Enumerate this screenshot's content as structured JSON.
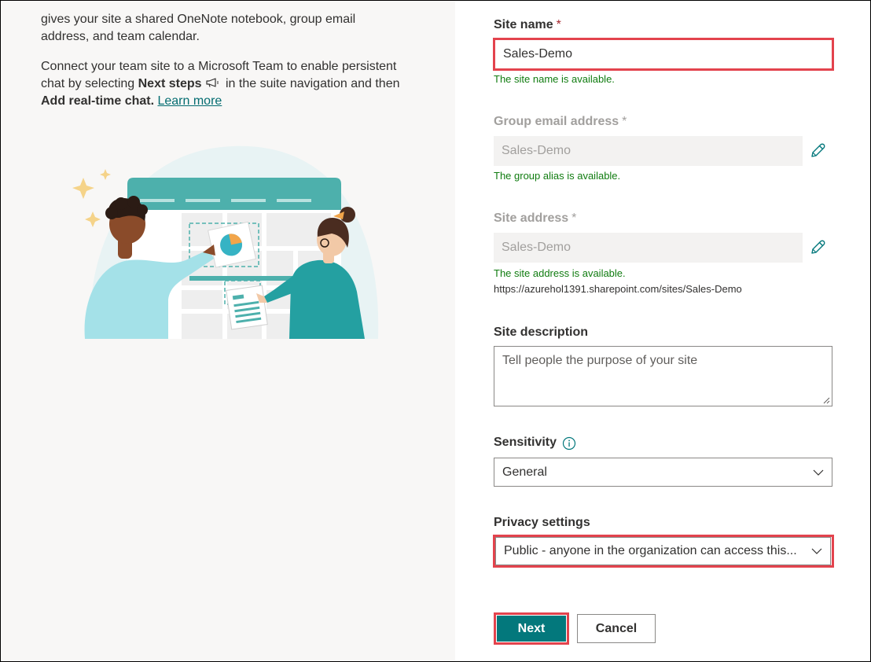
{
  "left": {
    "intro_line1": "gives your site a shared OneNote notebook, group email",
    "intro_line2": "address, and team calendar.",
    "connect_line1": "Connect your team site to a Microsoft Team to enable persistent",
    "connect_prefix": "chat by selecting ",
    "next_steps": "Next steps",
    "connect_suffix": " in the suite navigation and then",
    "add_chat": "Add real-time chat.",
    "learn_more": "Learn more"
  },
  "form": {
    "site_name": {
      "label": "Site name",
      "required": "*",
      "value": "Sales-Demo",
      "status": "The site name is available."
    },
    "group_email": {
      "label": "Group email address",
      "required": "*",
      "value": "Sales-Demo",
      "status": "The group alias is available."
    },
    "site_address": {
      "label": "Site address",
      "required": "*",
      "value": "Sales-Demo",
      "status": "The site address is available.",
      "url": "https://azurehol1391.sharepoint.com/sites/Sales-Demo"
    },
    "site_description": {
      "label": "Site description",
      "placeholder": "Tell people the purpose of your site"
    },
    "sensitivity": {
      "label": "Sensitivity",
      "selected": "General"
    },
    "privacy": {
      "label": "Privacy settings",
      "selected": "Public - anyone in the organization can access this..."
    }
  },
  "buttons": {
    "next": "Next",
    "cancel": "Cancel"
  },
  "colors": {
    "accent": "#03787c",
    "success": "#107c10",
    "highlight": "#e3434d",
    "required": "#a4262c"
  },
  "icons": {
    "edit": "pencil-icon",
    "info": "info-icon",
    "dropdown": "chevron-down-icon",
    "next_steps": "megaphone-icon"
  }
}
